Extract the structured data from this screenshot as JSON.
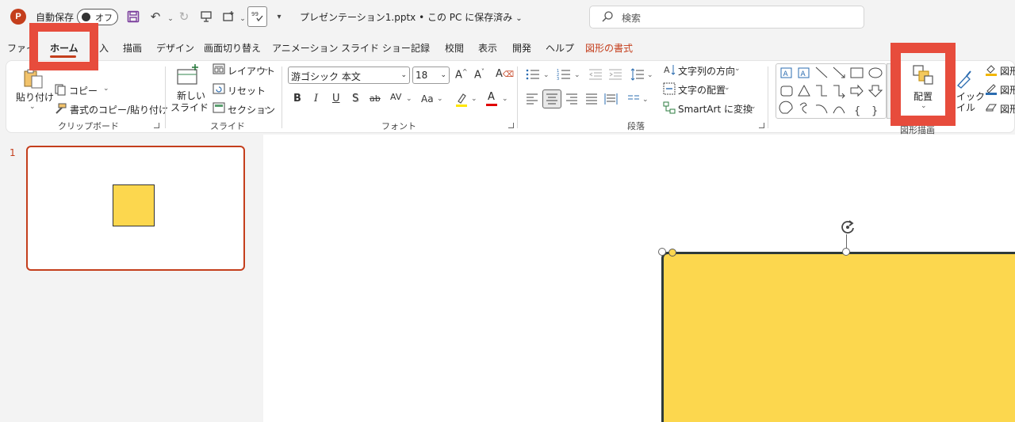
{
  "titlebar": {
    "app_logo": "P",
    "autosave_label": "自動保存",
    "autosave_state": "オフ",
    "doc_title": "プレゼンテーション1.pptx • この PC に保存済み",
    "search_placeholder": "検索"
  },
  "tabs": [
    "ファイル",
    "ホーム",
    "挿入",
    "描画",
    "デザイン",
    "画面切り替え",
    "アニメーション",
    "スライド ショー",
    "記録",
    "校閲",
    "表示",
    "開発",
    "ヘルプ",
    "図形の書式"
  ],
  "tabs_visible": {
    "file": "ファイ",
    "home": "ホーム",
    "insert": "入",
    "draw": "描画",
    "design": "デザイン",
    "transitions": "画面切り替え",
    "animations": "アニメーション",
    "slideshow": "スライド ショー",
    "record": "記録",
    "review": "校閲",
    "view": "表示",
    "developer": "開発",
    "help": "ヘルプ",
    "shape_format": "図形の書式"
  },
  "clipboard": {
    "paste": "貼り付け",
    "copy": "コピー",
    "format_painter": "書式のコピー/貼り付け",
    "label": "クリップボード"
  },
  "slides": {
    "new_slide_1": "新しい",
    "new_slide_2": "スライド",
    "layout": "レイアウト",
    "reset": "リセット",
    "section": "セクション",
    "label": "スライド"
  },
  "font": {
    "name": "游ゴシック 本文",
    "size": "18",
    "label": "フォント",
    "bold": "B",
    "italic": "I",
    "underline": "U",
    "shadow": "S",
    "strike": "ab",
    "spacing": "AV",
    "case": "Aa",
    "color": "A"
  },
  "paragraph": {
    "text_direction": "文字列の方向",
    "align_text": "文字の配置",
    "smartart": "SmartArt に変換",
    "label": "段落"
  },
  "drawing": {
    "arrange": "配置",
    "quick_style_1": "イック",
    "quick_style_2": "イル",
    "label": "図形描画",
    "shape_fill": "図形",
    "shape_outline": "図形",
    "shape_effects": "図形"
  },
  "slide_panel": {
    "number": "1"
  },
  "colors": {
    "accent": "#c43e1c",
    "highlight": "#e74c3c",
    "shape_fill": "#fcd74e"
  }
}
